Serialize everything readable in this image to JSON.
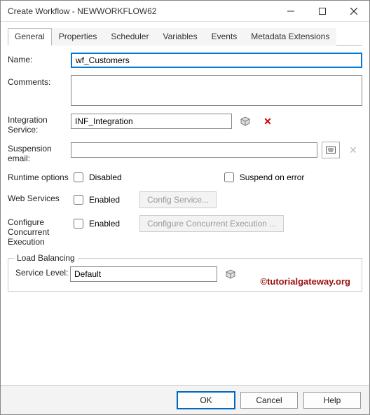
{
  "window": {
    "title": "Create Workflow - NEWWORKFLOW62"
  },
  "tabs": [
    "General",
    "Properties",
    "Scheduler",
    "Variables",
    "Events",
    "Metadata Extensions"
  ],
  "labels": {
    "name": "Name:",
    "comments": "Comments:",
    "integration": "Integration Service:",
    "suspension": "Suspension email:",
    "runtime": "Runtime options",
    "web": "Web Services",
    "concurrent": "Configure Concurrent Execution",
    "loadbal": "Load Balancing",
    "service_level": "Service Level:"
  },
  "fields": {
    "name": "wf_Customers",
    "comments": "",
    "integration": "INF_Integration",
    "suspension": "",
    "service_level": "Default"
  },
  "checks": {
    "disabled": "Disabled",
    "suspend_on_error": "Suspend on error",
    "web_enabled": "Enabled",
    "concurrent_enabled": "Enabled"
  },
  "buttons": {
    "config_service": "Config Service...",
    "config_concurrent": "Configure Concurrent Execution ...",
    "ok": "OK",
    "cancel": "Cancel",
    "help": "Help"
  },
  "watermark": "©tutorialgateway.org"
}
